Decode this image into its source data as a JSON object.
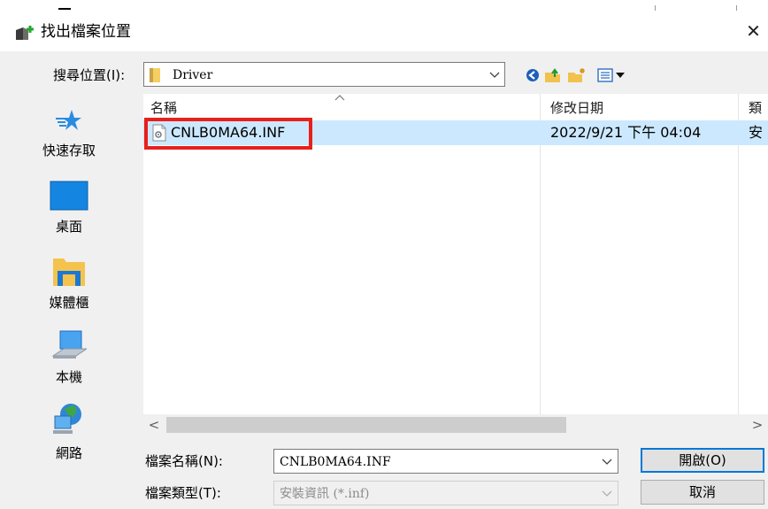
{
  "window": {
    "title": "找出檔案位置",
    "close_glyph": "✕",
    "icon": "folder-add-icon"
  },
  "look_in": {
    "label": "搜尋位置(I):",
    "value": "Driver",
    "toolbar_icons": [
      "back-icon",
      "up-folder-icon",
      "new-folder-icon",
      "view-menu-icon"
    ]
  },
  "places": [
    {
      "label": "快速存取",
      "icon": "quick-access-star-icon"
    },
    {
      "label": "桌面",
      "icon": "desktop-icon"
    },
    {
      "label": "媒體櫃",
      "icon": "libraries-icon"
    },
    {
      "label": "本機",
      "icon": "this-pc-icon"
    },
    {
      "label": "網路",
      "icon": "network-icon"
    }
  ],
  "file_list": {
    "columns": [
      "名稱",
      "修改日期",
      "類"
    ],
    "rows": [
      {
        "name": "CNLB0MA64.INF",
        "modified": "2022/9/21 下午 04:04",
        "type": "安",
        "selected": true
      }
    ],
    "scroll_left": "<",
    "scroll_right": ">"
  },
  "file_name": {
    "label": "檔案名稱(N):",
    "value": "CNLB0MA64.INF"
  },
  "file_type": {
    "label": "檔案類型(T):",
    "value": "安裝資訊 (*.inf)"
  },
  "buttons": {
    "open": "開啟(O)",
    "cancel": "取消"
  },
  "colors": {
    "selection": "#cce8ff",
    "highlight_box": "#e8201a",
    "accent": "#0078d7"
  }
}
